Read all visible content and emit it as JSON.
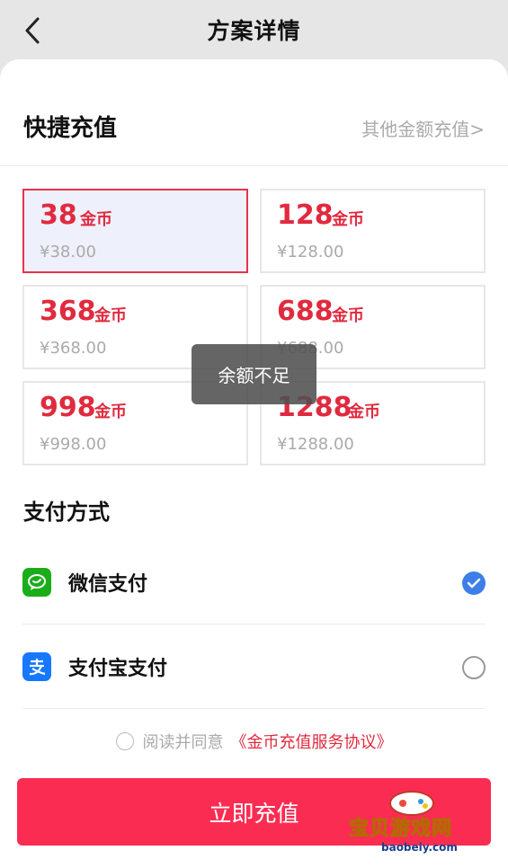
{
  "navbar": {
    "title": "方案详情"
  },
  "quick": {
    "title": "快捷充值",
    "other_link": "其他金额充值>"
  },
  "packages": [
    {
      "amount": "38",
      "unit": "金币",
      "price": "¥38.00",
      "selected": true
    },
    {
      "amount": "128",
      "unit": "金币",
      "price": "¥128.00",
      "selected": false
    },
    {
      "amount": "368",
      "unit": "金币",
      "price": "¥368.00",
      "selected": false
    },
    {
      "amount": "688",
      "unit": "金币",
      "price": "¥688.00",
      "selected": false
    },
    {
      "amount": "998",
      "unit": "金币",
      "price": "¥998.00",
      "selected": false
    },
    {
      "amount": "1288",
      "unit": "金币",
      "price": "¥1288.00",
      "selected": false
    }
  ],
  "toast": "余额不足",
  "payment": {
    "title": "支付方式",
    "methods": [
      {
        "label": "微信支付",
        "icon": "wechat-pay-icon",
        "color": "#1aad19",
        "checked": true
      },
      {
        "label": "支付宝支付",
        "icon": "alipay-icon",
        "color": "#1677ff",
        "checked": false
      }
    ]
  },
  "agreement": {
    "text": "阅读并同意",
    "link": "《金币充值服务协议》"
  },
  "submit_label": "立即充值",
  "watermark": {
    "text": "宝贝游戏网",
    "url": "baobeiy.com"
  },
  "colors": {
    "accent_red": "#e02a3f",
    "button_red": "#fb2c52",
    "check_blue": "#3d7fe9",
    "selected_bg": "#eef0fb"
  }
}
